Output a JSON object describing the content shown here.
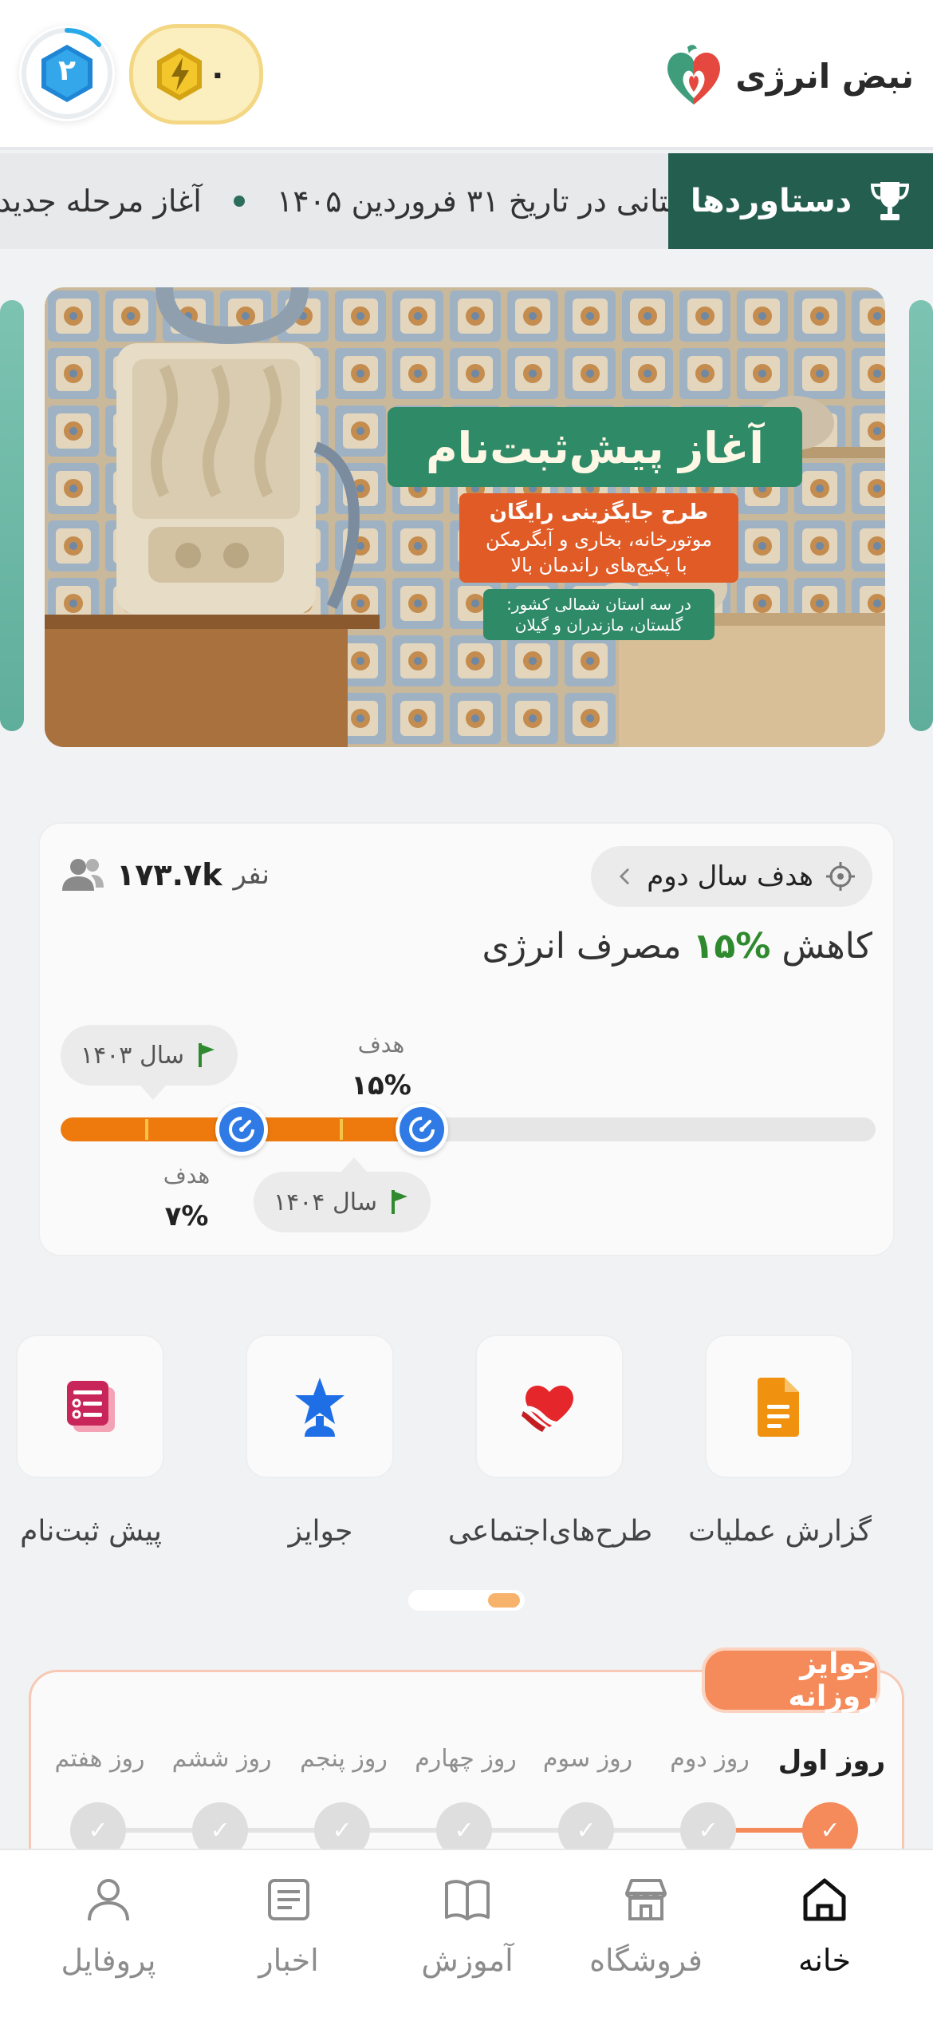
{
  "header": {
    "app_name": "نبض انرژی",
    "coins": "۰",
    "level": "۲"
  },
  "ticker": {
    "achievements_label": "دستاوردها",
    "messages": [
      "ستانی در تاریخ ۳۱ فروردین ۱۴۰۵",
      "آغاز مرحله جدید"
    ]
  },
  "banner": {
    "headline": "آغاز پیش‌ثبت‌نام",
    "line1": "طرح جایگزینی رایگان",
    "line2": "موتورخانه، بخاری و آبگرمکن",
    "line3": "با پکیج‌های راندمان بالا",
    "line4": "در سه استان شمالی کشور:",
    "line5": "گلستان، مازندران و گیلان"
  },
  "goal": {
    "chip_label": "هدف سال دوم",
    "participants_count": "۱۷۳.۷k",
    "participants_unit": "نفر",
    "title_prefix": "کاهش",
    "title_percent": "%۱۵",
    "title_suffix": "مصرف انرژی",
    "progress_fraction": 0.44,
    "year1_label": "سال ۱۴۰۳",
    "year2_label": "سال ۱۴۰۴",
    "target1_label": "هدف",
    "target1_value": "۷%",
    "target2_label": "هدف",
    "target2_value": "۱۵%"
  },
  "quick_menu": {
    "items": [
      {
        "label": "گزارش عملیات",
        "icon": "document-icon",
        "color": "#f0920f"
      },
      {
        "label": "طرح‌های‌اجتماعی",
        "icon": "heart-hand-icon",
        "color": "#e5262b"
      },
      {
        "label": "جوایز",
        "icon": "award-star-icon",
        "color": "#1e6fe6"
      },
      {
        "label": "پیش ثبت‌نام",
        "icon": "form-list-icon",
        "color": "#c8265a"
      }
    ]
  },
  "daily_rewards": {
    "title": "جوایز روزانه",
    "days": [
      "روز اول",
      "روز دوم",
      "روز سوم",
      "روز چهارم",
      "روز پنجم",
      "روز ششم",
      "روز هفتم"
    ],
    "active_day_index": 0
  },
  "nav": {
    "items": [
      {
        "label": "خانه",
        "icon": "home-icon",
        "active": true
      },
      {
        "label": "فروشگاه",
        "icon": "store-icon",
        "active": false
      },
      {
        "label": "آموزش",
        "icon": "book-icon",
        "active": false
      },
      {
        "label": "اخبار",
        "icon": "news-icon",
        "active": false
      },
      {
        "label": "پروفایل",
        "icon": "user-icon",
        "active": false
      }
    ]
  },
  "colors": {
    "brand_green": "#245e4f",
    "accent_orange": "#ee7a0e",
    "marker_blue": "#2f7ae5",
    "reward_coral": "#f58a5a"
  }
}
